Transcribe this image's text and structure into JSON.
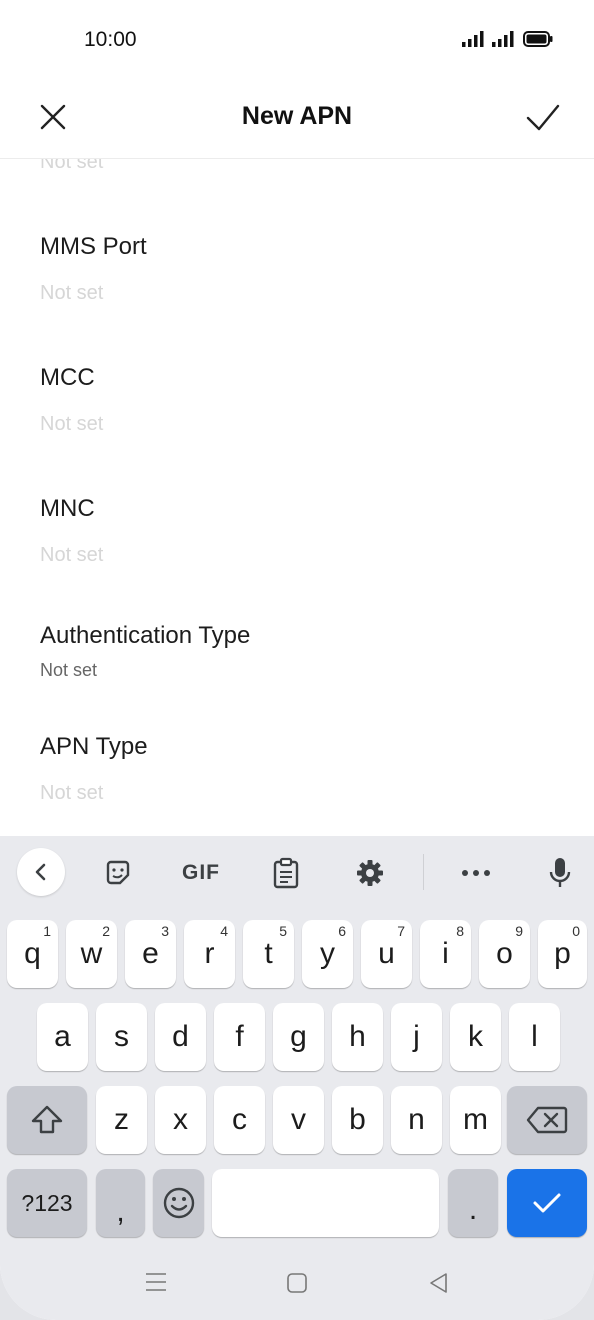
{
  "status_bar": {
    "time": "10:00"
  },
  "header": {
    "title": "New APN"
  },
  "fields": {
    "partial_value": "Not set",
    "mms_port": {
      "label": "MMS Port",
      "value": "Not set"
    },
    "mcc": {
      "label": "MCC",
      "value": "Not set"
    },
    "mnc": {
      "label": "MNC",
      "value": "Not set"
    },
    "auth_type": {
      "label": "Authentication Type",
      "value": "Not set"
    },
    "apn_type": {
      "label": "APN Type",
      "value": "Not set"
    }
  },
  "keyboard": {
    "toolbar": {
      "gif_label": "GIF"
    },
    "row1": [
      {
        "key": "q",
        "hint": "1"
      },
      {
        "key": "w",
        "hint": "2"
      },
      {
        "key": "e",
        "hint": "3"
      },
      {
        "key": "r",
        "hint": "4"
      },
      {
        "key": "t",
        "hint": "5"
      },
      {
        "key": "y",
        "hint": "6"
      },
      {
        "key": "u",
        "hint": "7"
      },
      {
        "key": "i",
        "hint": "8"
      },
      {
        "key": "o",
        "hint": "9"
      },
      {
        "key": "p",
        "hint": "0"
      }
    ],
    "row2": [
      "a",
      "s",
      "d",
      "f",
      "g",
      "h",
      "j",
      "k",
      "l"
    ],
    "row3": [
      "z",
      "x",
      "c",
      "v",
      "b",
      "n",
      "m"
    ],
    "symbols_label": "?123",
    "comma": ",",
    "period": "."
  },
  "colors": {
    "accent": "#1a73e8",
    "keyboard_bg": "#e9eaee",
    "placeholder": "#d6d6d6"
  }
}
